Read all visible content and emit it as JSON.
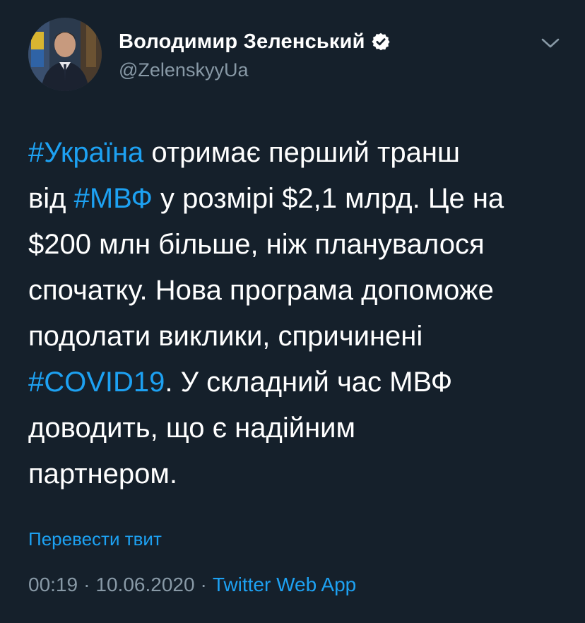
{
  "author": {
    "display_name": "Володимир Зеленський",
    "handle": "@ZelenskyyUa",
    "verified": true
  },
  "icons": {
    "verified": "verified-badge-icon",
    "menu": "chevron-down-icon"
  },
  "tweet": {
    "lines": [
      [
        {
          "t": "#Україна",
          "tag": true
        },
        {
          "t": " отримає перший транш",
          "tag": false
        }
      ],
      [
        {
          "t": "від ",
          "tag": false
        },
        {
          "t": "#МВФ",
          "tag": true
        },
        {
          "t": " у розмірі $2,1 млрд. Це на",
          "tag": false
        }
      ],
      [
        {
          "t": "$200 млн більше, ніж планувалося",
          "tag": false
        }
      ],
      [
        {
          "t": "спочатку. Нова програма допоможе",
          "tag": false
        }
      ],
      [
        {
          "t": "подолати виклики, спричинені",
          "tag": false
        }
      ],
      [
        {
          "t": "#COVID19",
          "tag": true
        },
        {
          "t": ". У складний час МВФ",
          "tag": false
        }
      ],
      [
        {
          "t": "доводить, що є надійним",
          "tag": false
        }
      ],
      [
        {
          "t": "партнером.",
          "tag": false
        }
      ]
    ]
  },
  "translate_label": "Перевести твит",
  "meta": {
    "time": "00:19",
    "separator": "·",
    "date": "10.06.2020",
    "source": "Twitter Web App"
  },
  "colors": {
    "background": "#15202b",
    "text": "#ffffff",
    "secondary": "#8899a6",
    "accent": "#1da1f2"
  }
}
